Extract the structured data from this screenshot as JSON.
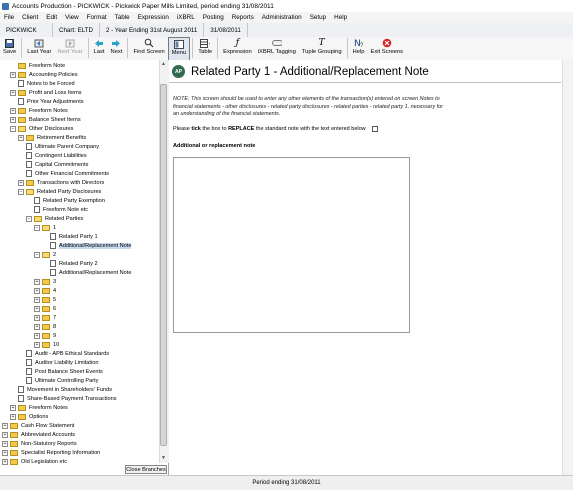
{
  "window": {
    "title": "Accounts Production - PICKWICK - Pickwick Paper Mills Limited, period ending 31/08/2011"
  },
  "menu": [
    "File",
    "Client",
    "Edit",
    "View",
    "Format",
    "Table",
    "Expression",
    "iXBRL",
    "Posting",
    "Reports",
    "Administration",
    "Setup",
    "Help"
  ],
  "infobar": {
    "client": "PICKWICK",
    "chart": "Chart: ELTD",
    "year": "2 - Year Ending 31st August 2011",
    "date": "31/08/2011"
  },
  "toolbar": {
    "save": "Save",
    "last_year": "Last Year",
    "next_year": "Next Year",
    "last": "Last",
    "next": "Next",
    "find_screen": "Find Screen",
    "menu": "Menu",
    "table": "Table",
    "expression": "Expression",
    "ixbrl_tagging": "iXBRL Tagging",
    "tuple_grouping": "Tuple Grouping",
    "help": "Help",
    "exit_screens": "Exit Screens"
  },
  "tree": [
    {
      "label": "Freeform Note",
      "depth": 2,
      "expander": "none",
      "icon": "folder"
    },
    {
      "label": "Accounting Policies",
      "depth": 2,
      "expander": "plus",
      "icon": "folder"
    },
    {
      "label": "Notes to be Forced",
      "depth": 2,
      "expander": "none",
      "icon": "doc"
    },
    {
      "label": "Profit and Loss Items",
      "depth": 2,
      "expander": "plus",
      "icon": "folder"
    },
    {
      "label": "Prior Year Adjustments",
      "depth": 2,
      "expander": "none",
      "icon": "doc"
    },
    {
      "label": "Freeform Notes",
      "depth": 2,
      "expander": "plus",
      "icon": "folder"
    },
    {
      "label": "Balance Sheet Items",
      "depth": 2,
      "expander": "plus",
      "icon": "folder"
    },
    {
      "label": "Other Disclosures",
      "depth": 2,
      "expander": "minus",
      "icon": "folder-open"
    },
    {
      "label": "Retirement Benefits",
      "depth": 3,
      "expander": "plus",
      "icon": "folder"
    },
    {
      "label": "Ultimate Parent Company",
      "depth": 3,
      "expander": "none",
      "icon": "doc"
    },
    {
      "label": "Contingent Liabilities",
      "depth": 3,
      "expander": "none",
      "icon": "doc"
    },
    {
      "label": "Capital Commitments",
      "depth": 3,
      "expander": "none",
      "icon": "doc"
    },
    {
      "label": "Other Financial Commitments",
      "depth": 3,
      "expander": "none",
      "icon": "doc"
    },
    {
      "label": "Transactions with Directors",
      "depth": 3,
      "expander": "plus",
      "icon": "folder"
    },
    {
      "label": "Related Party Disclosures",
      "depth": 3,
      "expander": "minus",
      "icon": "folder-open"
    },
    {
      "label": "Related Party Exemption",
      "depth": 4,
      "expander": "none",
      "icon": "doc"
    },
    {
      "label": "Freeform Note etc",
      "depth": 4,
      "expander": "none",
      "icon": "doc"
    },
    {
      "label": "Related Parties",
      "depth": 4,
      "expander": "minus",
      "icon": "folder-open"
    },
    {
      "label": "1",
      "depth": 5,
      "expander": "minus",
      "icon": "folder-open"
    },
    {
      "label": "Related Party 1",
      "depth": 6,
      "expander": "none",
      "icon": "doc"
    },
    {
      "label": "Additional/Replacement Note",
      "depth": 6,
      "expander": "none",
      "icon": "doc",
      "selected": true
    },
    {
      "label": "2",
      "depth": 5,
      "expander": "minus",
      "icon": "folder-open"
    },
    {
      "label": "Related Party 2",
      "depth": 6,
      "expander": "none",
      "icon": "doc"
    },
    {
      "label": "Additional/Replacement Note",
      "depth": 6,
      "expander": "none",
      "icon": "doc"
    },
    {
      "label": "3",
      "depth": 5,
      "expander": "plus",
      "icon": "folder"
    },
    {
      "label": "4",
      "depth": 5,
      "expander": "plus",
      "icon": "folder"
    },
    {
      "label": "5",
      "depth": 5,
      "expander": "plus",
      "icon": "folder"
    },
    {
      "label": "6",
      "depth": 5,
      "expander": "plus",
      "icon": "folder"
    },
    {
      "label": "7",
      "depth": 5,
      "expander": "plus",
      "icon": "folder"
    },
    {
      "label": "8",
      "depth": 5,
      "expander": "plus",
      "icon": "folder"
    },
    {
      "label": "9",
      "depth": 5,
      "expander": "plus",
      "icon": "folder"
    },
    {
      "label": "10",
      "depth": 5,
      "expander": "plus",
      "icon": "folder"
    },
    {
      "label": "Audit - APB Ethical Standards",
      "depth": 3,
      "expander": "none",
      "icon": "doc"
    },
    {
      "label": "Auditor Liability Limitation",
      "depth": 3,
      "expander": "none",
      "icon": "doc"
    },
    {
      "label": "Post Balance Sheet Events",
      "depth": 3,
      "expander": "none",
      "icon": "doc"
    },
    {
      "label": "Ultimate Controlling Party",
      "depth": 3,
      "expander": "none",
      "icon": "doc"
    },
    {
      "label": "Movement in Shareholders' Funds",
      "depth": 2,
      "expander": "none",
      "icon": "doc"
    },
    {
      "label": "Share-Based Payment Transactions",
      "depth": 2,
      "expander": "none",
      "icon": "doc"
    },
    {
      "label": "Freeform Notes",
      "depth": 2,
      "expander": "plus",
      "icon": "folder"
    },
    {
      "label": "Options",
      "depth": 2,
      "expander": "plus",
      "icon": "folder"
    },
    {
      "label": "Cash Flow Statement",
      "depth": 1,
      "expander": "plus",
      "icon": "folder"
    },
    {
      "label": "Abbreviated Accounts",
      "depth": 1,
      "expander": "plus",
      "icon": "folder"
    },
    {
      "label": "Non-Statutory Reports",
      "depth": 1,
      "expander": "plus",
      "icon": "folder"
    },
    {
      "label": "Specialist Reporting Information",
      "depth": 1,
      "expander": "plus",
      "icon": "folder"
    },
    {
      "label": "Old Legislation etc",
      "depth": 1,
      "expander": "plus",
      "icon": "folder"
    }
  ],
  "collapse_button": "Close Branches",
  "main": {
    "title": "Related Party 1 - Additional/Replacement Note",
    "icon_text": "AP",
    "note": "NOTE: This screen should be used to enter any other elements of the transaction(s) entered on screen Notes to financial statements - other disclosures - related party disclosures - related parties - related party 1, necessary for an understanding of the financial statements.",
    "tick_prefix": "Please ",
    "tick_b1": "tick",
    "tick_mid": " the box to ",
    "tick_b2": "REPLACE",
    "tick_suffix": " the standard note with the text entered below",
    "tick_checked": false,
    "additional_label": "Additional or replacement note",
    "textarea_value": ""
  },
  "status": {
    "text": "Period ending 31/08/2011"
  },
  "colors": {
    "accent": "#3a6fb0",
    "folder": "#f2c94c",
    "ap_icon": "#2f6b4f",
    "selected": "#c9d9f0"
  }
}
